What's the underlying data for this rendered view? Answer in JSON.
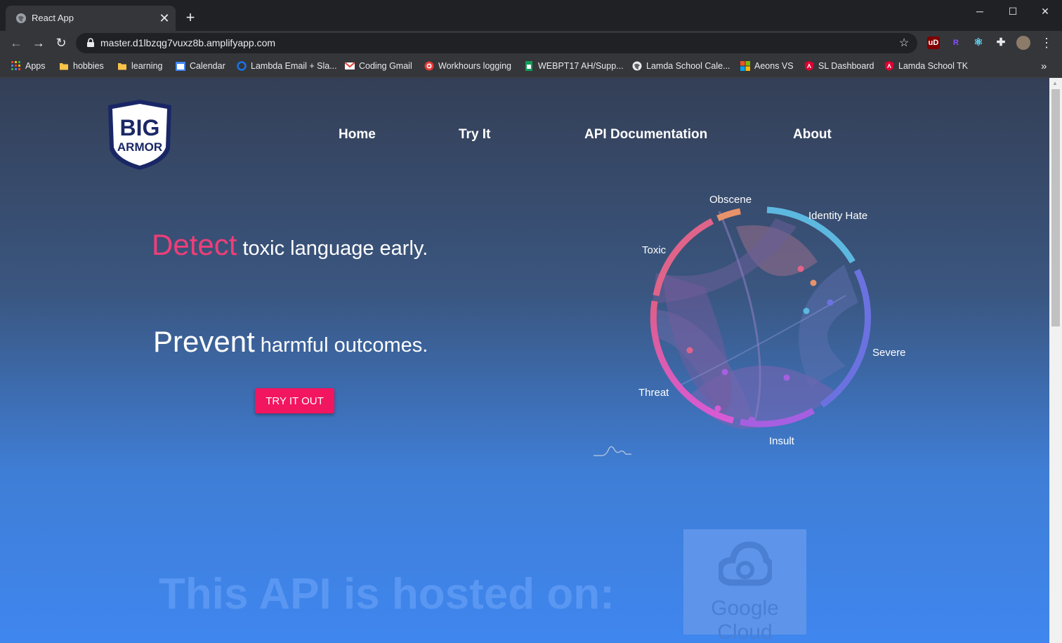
{
  "browser": {
    "tab_title": "React App",
    "tab_close": "✕",
    "new_tab": "+",
    "window_controls": {
      "minimize": "─",
      "maximize": "☐",
      "close": "✕"
    },
    "nav": {
      "back": "←",
      "forward": "→",
      "reload": "↻"
    },
    "url": "master.d1lbzqg7vuxz8b.amplifyapp.com",
    "bookmark_star": "☆",
    "extensions": [
      {
        "label": "uD",
        "color": "#800000"
      },
      {
        "label": "R",
        "color": "#8a4fff"
      },
      {
        "label": "⚛",
        "color": "#61dafb"
      },
      {
        "label": "✚",
        "color": "#e8eaed"
      }
    ],
    "menu": "⋮",
    "bookmarks": [
      {
        "label": "Apps",
        "icon": "apps-grid-icon",
        "color": "#ea4335"
      },
      {
        "label": "hobbies",
        "icon": "folder-icon",
        "color": "#f8c34a"
      },
      {
        "label": "learning",
        "icon": "folder-icon",
        "color": "#f8c34a"
      },
      {
        "label": "Calendar",
        "icon": "calendar-icon",
        "color": "#4285f4"
      },
      {
        "label": "Lambda Email + Sla...",
        "icon": "ring-icon",
        "color": "#1a73e8"
      },
      {
        "label": "Coding Gmail",
        "icon": "gmail-icon",
        "color": "#ea4335"
      },
      {
        "label": "Workhours logging",
        "icon": "target-icon",
        "color": "#e53935"
      },
      {
        "label": "WEBPT17 AH/Supp...",
        "icon": "sheets-icon",
        "color": "#0f9d58"
      },
      {
        "label": "Lamda School Cale...",
        "icon": "globe-icon",
        "color": "#e8eaed"
      },
      {
        "label": "Aeons VS",
        "icon": "microsoft-icon",
        "color": "#f25022"
      },
      {
        "label": "SL Dashboard",
        "icon": "angular-icon",
        "color": "#dd0031"
      },
      {
        "label": "Lamda School TK",
        "icon": "angular-icon",
        "color": "#dd0031"
      }
    ],
    "bookmarks_overflow": "»"
  },
  "site": {
    "logo_line1": "BIG",
    "logo_line2": "ARMOR",
    "nav": [
      "Home",
      "Try It",
      "API Documentation",
      "About"
    ],
    "hero": {
      "line1_accent": "Detect",
      "line1_rest": " toxic language early.",
      "line2_big": "Prevent",
      "line2_rest": " harmful outcomes.",
      "cta": "TRY IT OUT"
    },
    "chord_labels": [
      "Obscene",
      "Identity Hate",
      "Toxic",
      "Severe",
      "Threat",
      "Insult"
    ],
    "hosted_text": "This API is hosted on:",
    "cloud_name": "Google Cloud"
  },
  "colors": {
    "accent_pink": "#ef3e78",
    "cta_bg": "#f2155f",
    "page_top": "#343f56",
    "page_bottom": "#3f86ef"
  }
}
